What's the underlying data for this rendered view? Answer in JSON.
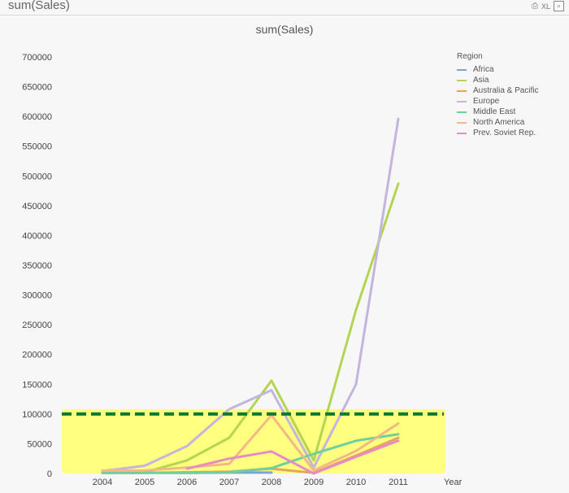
{
  "caption": {
    "title": "sum(Sales)",
    "icons": [
      {
        "name": "print-icon",
        "glyph": "⎙"
      },
      {
        "name": "xl-icon",
        "glyph": "XL"
      },
      {
        "name": "minimize-icon",
        "glyph": "⌕"
      }
    ]
  },
  "chart_data": {
    "type": "line",
    "title": "sum(Sales)",
    "xlabel": "Year",
    "ylabel": "",
    "categories": [
      "2004",
      "2005",
      "2006",
      "2007",
      "2008",
      "2009",
      "2010",
      "2011"
    ],
    "ylim": [
      0,
      700000
    ],
    "yticks": [
      0,
      50000,
      100000,
      150000,
      200000,
      250000,
      300000,
      350000,
      400000,
      450000,
      500000,
      550000,
      600000,
      650000,
      700000
    ],
    "legend_title": "Region",
    "legend_position": "top-right",
    "reference_line": {
      "value": 100000,
      "color": "#0b7a35",
      "style": "dashed"
    },
    "highlight_band": {
      "from": 0,
      "to": 100000,
      "color": "#ffff80"
    },
    "series": [
      {
        "name": "Africa",
        "color": "#7aa4d6",
        "values": [
          1000,
          1500,
          1000,
          1500,
          1500,
          null,
          null,
          null
        ]
      },
      {
        "name": "Asia",
        "color": "#b4d453",
        "values": [
          1000,
          2000,
          22000,
          60000,
          156000,
          22000,
          275000,
          487000
        ]
      },
      {
        "name": "Australia & Pacific",
        "color": "#e8a45c",
        "values": [
          1000,
          1000,
          2000,
          3000,
          8000,
          1000,
          30000,
          60000
        ]
      },
      {
        "name": "Europe",
        "color": "#c3b5dd",
        "values": [
          4000,
          13000,
          46000,
          108000,
          140000,
          10000,
          150000,
          596000
        ]
      },
      {
        "name": "Middle East",
        "color": "#6fcf9f",
        "values": [
          1000,
          1000,
          1000,
          2000,
          9000,
          33000,
          55000,
          66000
        ]
      },
      {
        "name": "North America",
        "color": "#f2b886",
        "values": [
          5000,
          5000,
          10000,
          16000,
          98000,
          5000,
          38000,
          84000
        ]
      },
      {
        "name": "Prev. Soviet Rep.",
        "color": "#e88ac7",
        "values": [
          null,
          null,
          8000,
          25000,
          37000,
          0,
          28000,
          55000
        ]
      }
    ]
  }
}
